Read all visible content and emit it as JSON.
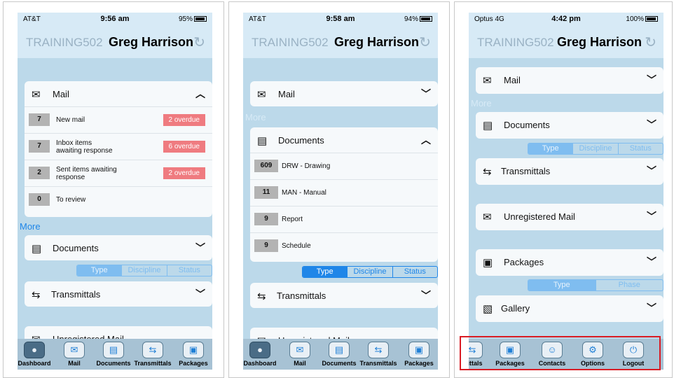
{
  "screens": [
    {
      "status": {
        "carrier": "AT&T",
        "time": "9:56 am",
        "battery": "95%"
      },
      "header": {
        "project_code": "TRAINING502",
        "user_name": "Greg Harrison"
      },
      "mail": {
        "title": "Mail",
        "rows": [
          {
            "count": "7",
            "label": "New mail",
            "overdue": "2 overdue"
          },
          {
            "count": "7",
            "label": "Inbox items awaiting response",
            "overdue": "6 overdue"
          },
          {
            "count": "2",
            "label": "Sent items awaiting response",
            "overdue": "2 overdue"
          },
          {
            "count": "0",
            "label": "To review",
            "overdue": ""
          }
        ]
      },
      "more_label": "More",
      "documents": {
        "title": "Documents",
        "segments": [
          "Type",
          "Discipline",
          "Status"
        ]
      },
      "transmittals": {
        "title": "Transmittals"
      },
      "unregistered": {
        "title": "Unregistered Mail"
      },
      "tabs": [
        "Dashboard",
        "Mail",
        "Documents",
        "Transmittals",
        "Packages"
      ]
    },
    {
      "status": {
        "carrier": "AT&T",
        "time": "9:58 am",
        "battery": "94%"
      },
      "header": {
        "project_code": "TRAINING502",
        "user_name": "Greg Harrison"
      },
      "mail": {
        "title": "Mail"
      },
      "more_label": "More",
      "documents": {
        "title": "Documents",
        "rows": [
          {
            "count": "609",
            "label": "DRW - Drawing"
          },
          {
            "count": "11",
            "label": "MAN - Manual"
          },
          {
            "count": "9",
            "label": "Report"
          },
          {
            "count": "9",
            "label": "Schedule"
          }
        ],
        "segments": [
          "Type",
          "Discipline",
          "Status"
        ]
      },
      "transmittals": {
        "title": "Transmittals"
      },
      "unregistered": {
        "title": "Unregistered Mail"
      },
      "tabs": [
        "Dashboard",
        "Mail",
        "Documents",
        "Transmittals",
        "Packages"
      ]
    },
    {
      "status": {
        "carrier": "Optus 4G",
        "time": "4:42 pm",
        "battery": "100%"
      },
      "header": {
        "project_code": "TRAINING502",
        "user_name": "Greg Harrison"
      },
      "mail": {
        "title": "Mail"
      },
      "more_label": "More",
      "documents": {
        "title": "Documents",
        "segments": [
          "Type",
          "Discipline",
          "Status"
        ]
      },
      "transmittals": {
        "title": "Transmittals"
      },
      "unregistered": {
        "title": "Unregistered Mail"
      },
      "packages": {
        "title": "Packages",
        "segments": [
          "Type",
          "Phase"
        ]
      },
      "gallery": {
        "title": "Gallery"
      },
      "tabs": [
        "mittals",
        "Packages",
        "Contacts",
        "Options",
        "Logout"
      ]
    }
  ],
  "colors": {
    "accent": "#1f86e8",
    "overdue": "#ef7b80",
    "highlight": "#d91c24"
  }
}
